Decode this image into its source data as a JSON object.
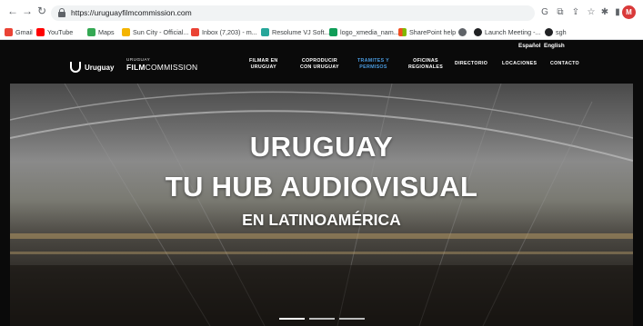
{
  "browser": {
    "url": "https://uruguayfilmcommission.com",
    "profile_initial": "M"
  },
  "bookmarks": [
    {
      "label": "Gmail",
      "icon": "gmail-icon",
      "color": "#ea4335"
    },
    {
      "label": "YouTube",
      "icon": "youtube-icon",
      "color": "#ff0000"
    },
    {
      "label": "Maps",
      "icon": "maps-icon",
      "color": "#34a853"
    },
    {
      "label": "Sun City - Official...",
      "icon": "suncity-icon",
      "color": "#f4b400"
    },
    {
      "label": "Inbox (7,203) - m...",
      "icon": "gmail-icon",
      "color": "#ea4335"
    },
    {
      "label": "Resolume VJ Soft...",
      "icon": "resolume-icon",
      "color": "#26a69a"
    },
    {
      "label": "logo_xmedia_nam...",
      "icon": "drive-icon",
      "color": "#0f9d58"
    },
    {
      "label": "SharePoint help",
      "icon": "microsoft-icon",
      "color": "#f25022"
    },
    {
      "label": "",
      "icon": "gear-icon",
      "color": "#5f6368"
    },
    {
      "label": "Launch Meeting -...",
      "icon": "globe-icon",
      "color": "#202124"
    },
    {
      "label": "sgh",
      "icon": "globe-icon",
      "color": "#202124"
    }
  ],
  "site": {
    "languages": [
      "Español",
      "English"
    ],
    "brand_uruguay": "Uruguay",
    "fc_small": "URUGUAY",
    "fc_big_bold": "FILM",
    "fc_big_light": "COMMISSION",
    "nav": [
      {
        "line1": "FILMAR EN",
        "line2": "URUGUAY"
      },
      {
        "line1": "COPRODUCIR",
        "line2": "CON URUGUAY"
      },
      {
        "line1": "TRAMITES Y",
        "line2": "PERMISOS"
      },
      {
        "line1": "OFICINAS",
        "line2": "REGIONALES"
      },
      {
        "line1": "DIRECTORIO",
        "line2": ""
      },
      {
        "line1": "LOCACIONES",
        "line2": ""
      },
      {
        "line1": "CONTACTO",
        "line2": ""
      }
    ],
    "active_nav_index": 2,
    "hero": {
      "line1": "URUGUAY",
      "line2": "TU HUB AUDIOVISUAL",
      "line3": "EN LATINOAMÉRICA",
      "slide_count": 3,
      "active_slide": 0
    }
  },
  "colors": {
    "active_nav": "#4a9be0",
    "site_background": "#0a0a0a"
  }
}
